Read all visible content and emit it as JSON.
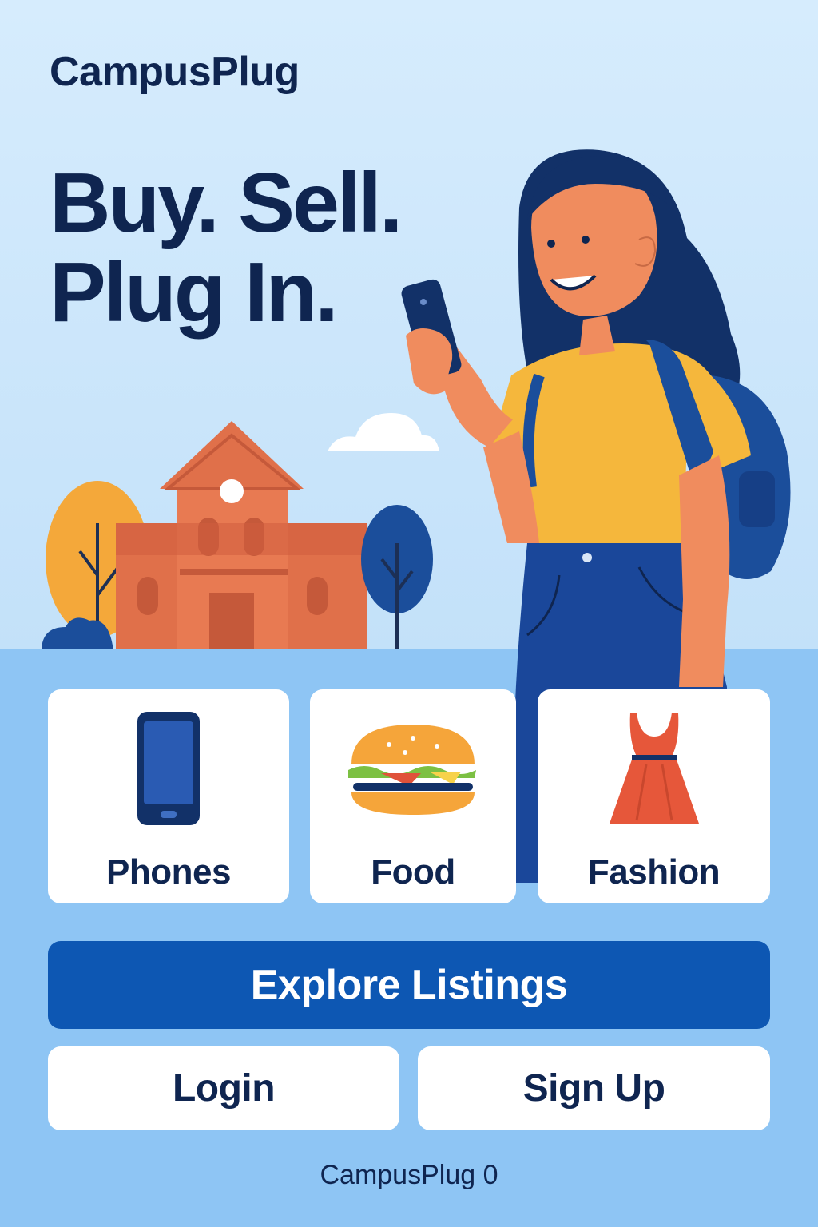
{
  "app": {
    "brand": "CampusPlug"
  },
  "hero": {
    "headline_line1": "Buy. Sell.",
    "headline_line2": "Plug In."
  },
  "categories": [
    {
      "label": "Phones",
      "icon": "phone-icon"
    },
    {
      "label": "Food",
      "icon": "burger-icon"
    },
    {
      "label": "Fashion",
      "icon": "dress-icon"
    }
  ],
  "actions": {
    "explore_label": "Explore Listings",
    "login_label": "Login",
    "signup_label": "Sign Up"
  },
  "footer": {
    "text": "CampusPlug 0"
  },
  "colors": {
    "primary": "#0d57b3",
    "text": "#0f2550",
    "hero_bg": "#d6ecfd",
    "lower_bg": "#8ec5f4"
  }
}
